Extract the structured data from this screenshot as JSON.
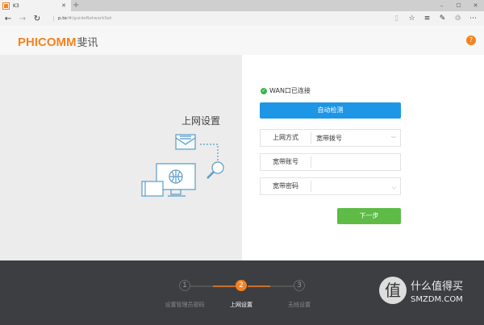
{
  "browser": {
    "tab_title": "K3",
    "url_host": "p.to",
    "url_path": "/#/guideNetworkSet"
  },
  "header": {
    "logo_en": "PHICOMM",
    "logo_cn": "斐讯",
    "help": "?"
  },
  "left": {
    "title": "上网设置"
  },
  "form": {
    "wan_status": "WAN口已连接",
    "auto_detect": "自动检测",
    "mode_label": "上网方式",
    "mode_value": "宽带拨号",
    "account_label": "宽带账号",
    "account_value": "",
    "password_label": "宽带密码",
    "password_value": "",
    "next": "下一步"
  },
  "steps": [
    {
      "num": "1",
      "label": "设置管理员密码"
    },
    {
      "num": "2",
      "label": "上网设置",
      "active": true
    },
    {
      "num": "3",
      "label": "无线设置"
    }
  ],
  "watermark": {
    "icon": "值",
    "cn": "什么值得买",
    "en": "SMZDM.COM"
  }
}
